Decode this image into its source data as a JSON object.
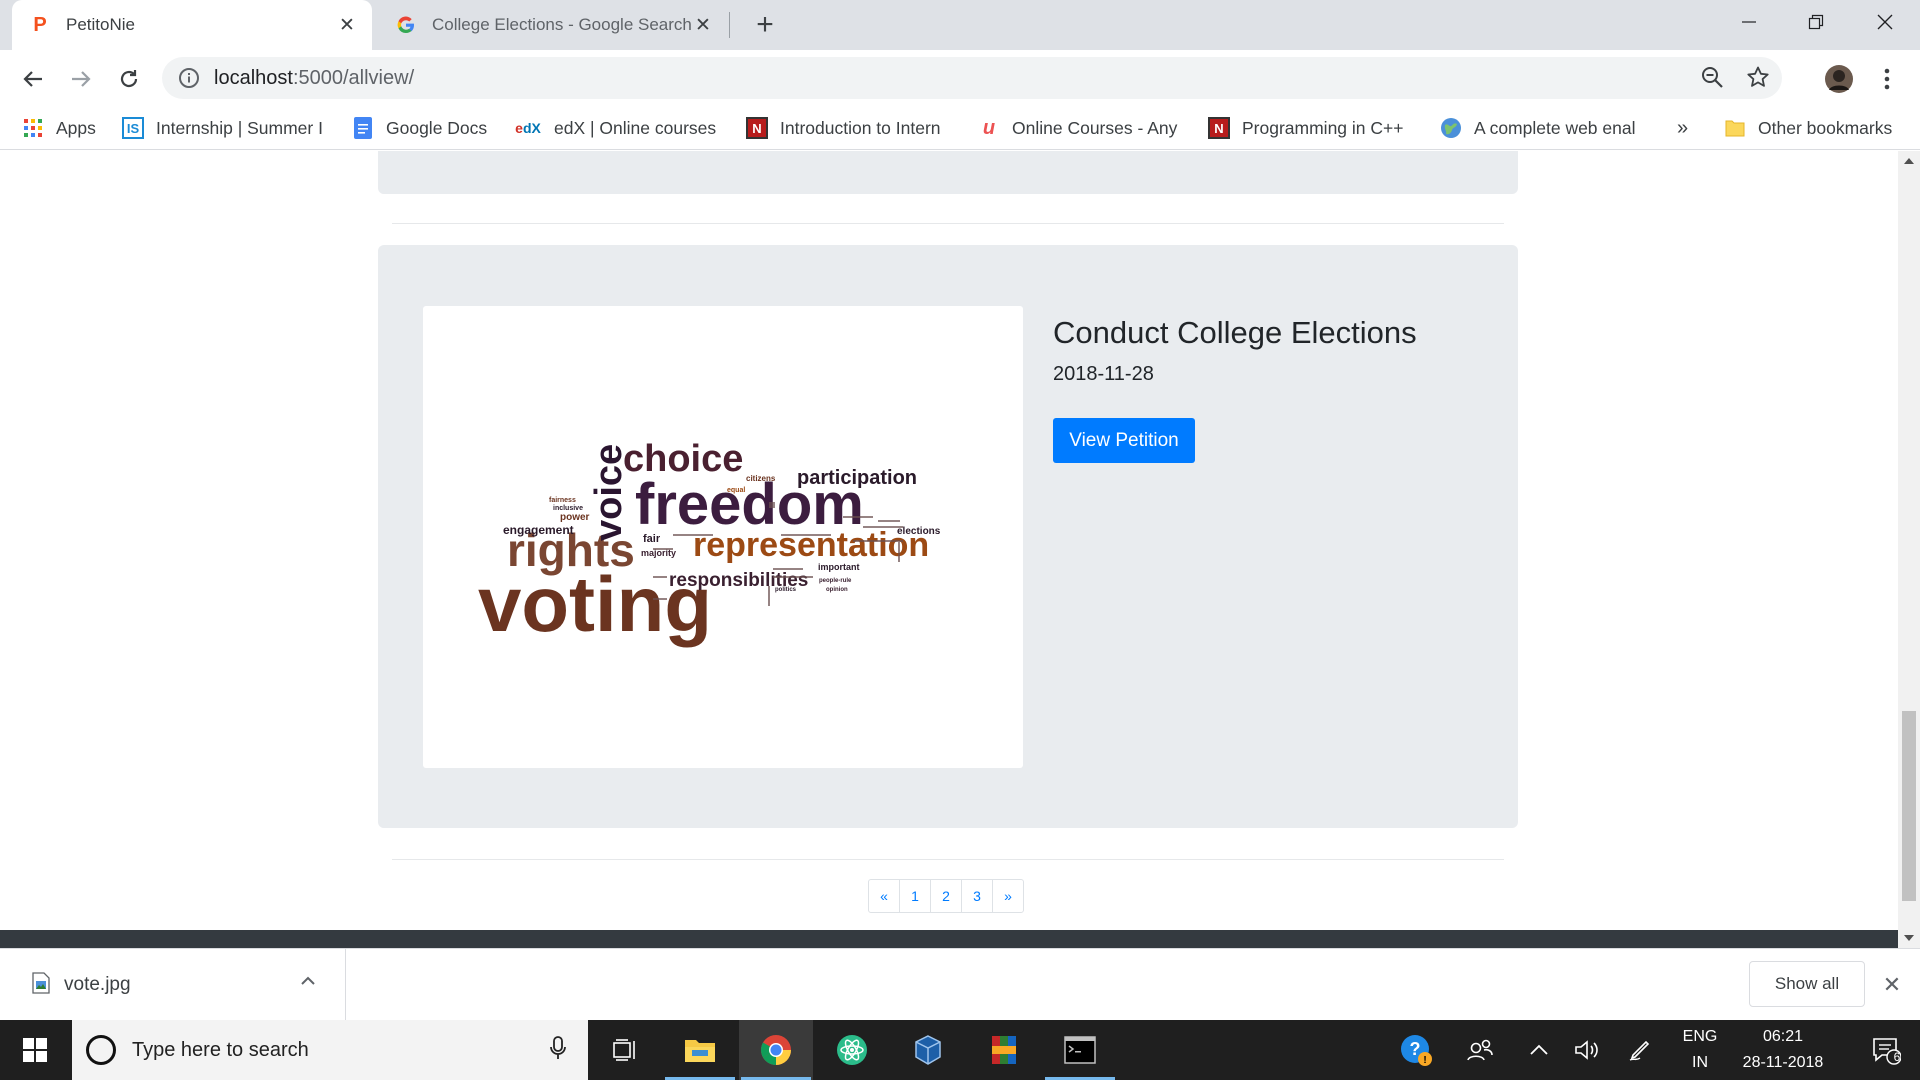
{
  "tabs": [
    {
      "title": "PetitoNie",
      "active": true,
      "icon": "petitonie-favicon"
    },
    {
      "title": "College Elections - Google Search",
      "active": false,
      "icon": "google-favicon"
    }
  ],
  "address_bar": {
    "host": "localhost",
    "path": ":5000/allview/"
  },
  "bookmarks": [
    {
      "label": "Apps",
      "icon": "apps-grid-icon"
    },
    {
      "label": "Internship | Summer I",
      "icon": "internshala-icon"
    },
    {
      "label": "Google Docs",
      "icon": "google-docs-icon"
    },
    {
      "label": "edX | Online courses",
      "icon": "edx-icon"
    },
    {
      "label": "Introduction to Intern",
      "icon": "nptel-icon"
    },
    {
      "label": "Online Courses - Any",
      "icon": "udemy-icon"
    },
    {
      "label": "Programming in C++",
      "icon": "nptel-icon"
    },
    {
      "label": "A complete web enal",
      "icon": "globe-icon"
    }
  ],
  "bookmarks_overflow": "»",
  "other_bookmarks": "Other bookmarks",
  "petition": {
    "title": "Conduct College Elections",
    "date": "2018-11-28",
    "button": "View Petition",
    "image_words": [
      "voting",
      "freedom",
      "rights",
      "choice",
      "voice",
      "representation",
      "participation",
      "responsibilities",
      "engagement",
      "power",
      "citizens",
      "elections",
      "fair",
      "majority",
      "important",
      "equal",
      "inclusive",
      "fairness",
      "people-rule",
      "politics",
      "opinion"
    ]
  },
  "pagination": [
    "«",
    "1",
    "2",
    "3",
    "»"
  ],
  "download": {
    "filename": "vote.jpg",
    "show_all": "Show all"
  },
  "taskbar": {
    "search_placeholder": "Type here to search",
    "lang_top": "ENG",
    "lang_bottom": "IN",
    "time": "06:21",
    "date": "28-11-2018",
    "notification_count": "6"
  }
}
